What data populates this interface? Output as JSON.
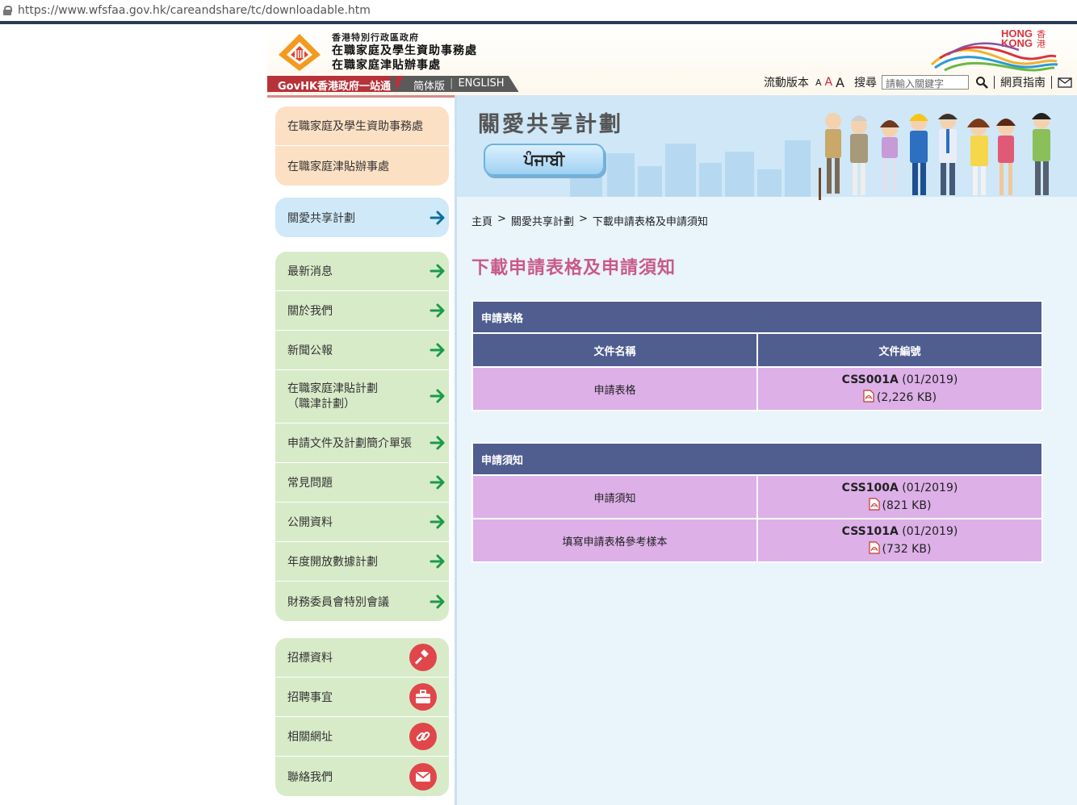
{
  "browser": {
    "url": "https://www.wfsfaa.gov.hk/careandshare/tc/downloadable.htm"
  },
  "header": {
    "org_line1": "香港特別行政區政府",
    "org_line2": "在職家庭及學生資助事務處",
    "org_line3": "在職家庭津貼辦事處",
    "brand_logo_text": "HONG KONG 香港",
    "govhk": "GovHK香港政府一站通",
    "lang_simplified": "简体版",
    "lang_english": "ENGLISH",
    "mobile_version": "流動版本",
    "font_small": "A",
    "font_medium": "A",
    "font_large": "A",
    "search_label": "搜尋",
    "search_placeholder": "請輸入關鍵字",
    "site_guide": "網頁指南"
  },
  "sidebar": {
    "offices": [
      {
        "label": "在職家庭及學生資助事務處"
      },
      {
        "label": "在職家庭津貼辦事處"
      }
    ],
    "scheme": {
      "label": "關愛共享計劃"
    },
    "menu": [
      {
        "label": "最新消息"
      },
      {
        "label": "關於我們"
      },
      {
        "label": "新聞公報"
      },
      {
        "label_line1": "在職家庭津貼計劃",
        "label_line2": "（職津計劃）"
      },
      {
        "label": "申請文件及計劃簡介單張"
      },
      {
        "label": "常見問題"
      },
      {
        "label": "公開資料"
      },
      {
        "label": "年度開放數據計劃"
      },
      {
        "label": "財務委員會特別會議"
      }
    ],
    "extra": [
      {
        "label": "招標資料",
        "icon": "gavel-icon"
      },
      {
        "label": "招聘事宜",
        "icon": "briefcase-icon"
      },
      {
        "label": "相關網址",
        "icon": "link-icon"
      },
      {
        "label": "聯絡我們",
        "icon": "envelope-icon"
      }
    ]
  },
  "banner": {
    "title": "關愛共享計劃",
    "language_button": "ਪੰਜਾਬੀ"
  },
  "breadcrumb": {
    "home": "主頁",
    "sep": ">",
    "scheme": "關愛共享計劃",
    "current": "下載申請表格及申請須知"
  },
  "page_title": "下載申請表格及申請須知",
  "forms_table": {
    "caption": "申請表格",
    "col_name": "文件名稱",
    "col_code": "文件編號",
    "rows": [
      {
        "name": "申請表格",
        "code": "CSS001A",
        "date": "(01/2019)",
        "size": "(2,226 KB)"
      }
    ]
  },
  "notes_table": {
    "caption": "申請須知",
    "rows": [
      {
        "name": "申請須知",
        "code": "CSS100A",
        "date": "(01/2019)",
        "size": "(821 KB)"
      },
      {
        "name": "填寫申請表格參考樣本",
        "code": "CSS101A",
        "date": "(01/2019)",
        "size": "(732 KB)"
      }
    ]
  },
  "colors": {
    "nav_orange": "#fce0c4",
    "nav_blue": "#cfe9f8",
    "nav_green": "#d8ebc9",
    "table_header": "#4f5d8f",
    "table_row": "#ddb0e8",
    "title_pink": "#c95a8a",
    "arrow_green": "#1a9a4a",
    "icon_red": "#e0464a"
  }
}
